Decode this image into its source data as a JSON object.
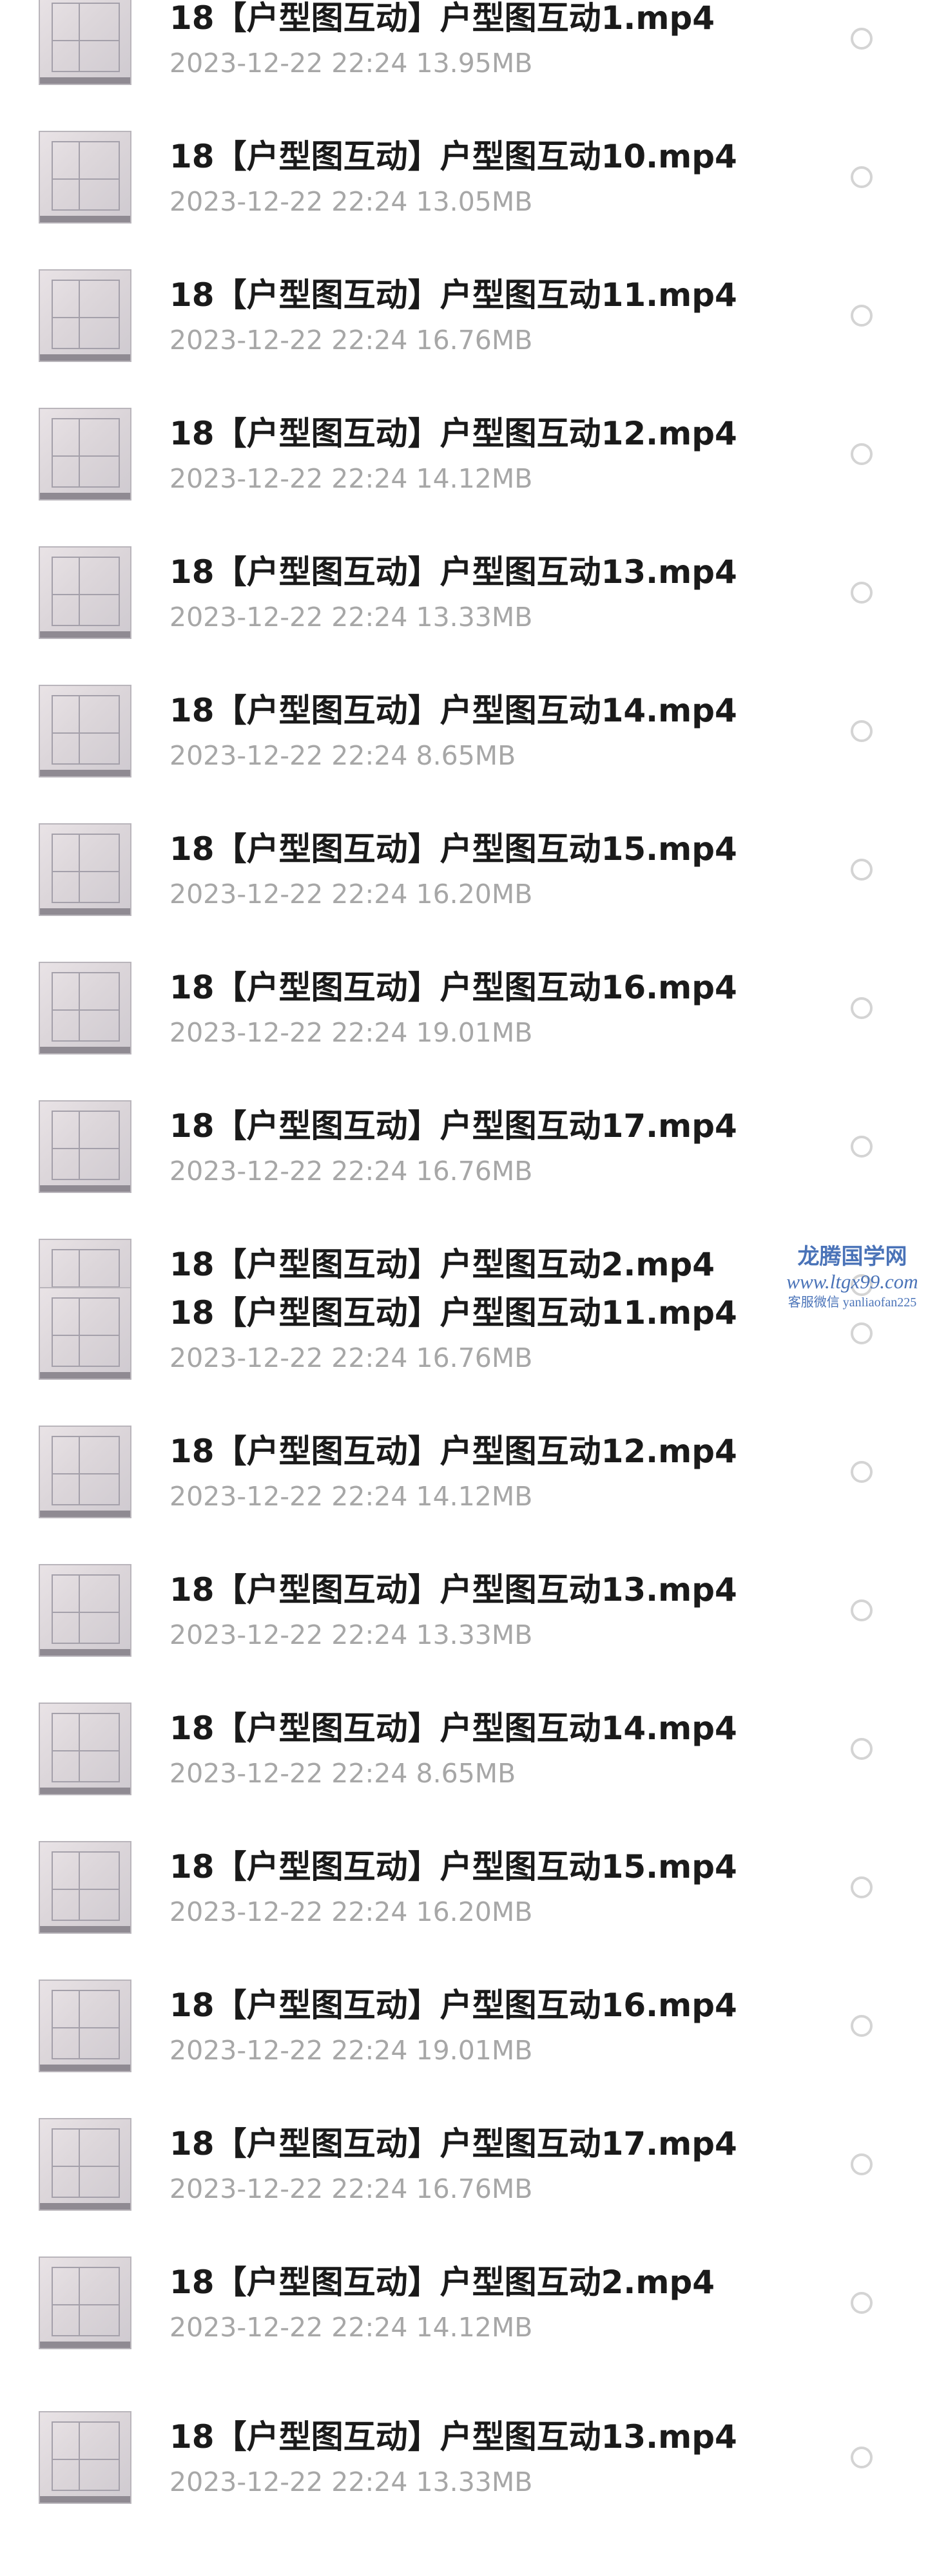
{
  "file_list": [
    {
      "name": "18【户型图互动】户型图互动1.mp4",
      "meta": "2023-12-22  22:24  13.95MB"
    },
    {
      "name": "18【户型图互动】户型图互动10.mp4",
      "meta": "2023-12-22  22:24  13.05MB"
    },
    {
      "name": "18【户型图互动】户型图互动11.mp4",
      "meta": "2023-12-22  22:24  16.76MB"
    },
    {
      "name": "18【户型图互动】户型图互动12.mp4",
      "meta": "2023-12-22  22:24  14.12MB"
    },
    {
      "name": "18【户型图互动】户型图互动13.mp4",
      "meta": "2023-12-22  22:24  13.33MB"
    },
    {
      "name": "18【户型图互动】户型图互动14.mp4",
      "meta": "2023-12-22  22:24  8.65MB"
    },
    {
      "name": "18【户型图互动】户型图互动15.mp4",
      "meta": "2023-12-22  22:24  16.20MB"
    },
    {
      "name": "18【户型图互动】户型图互动16.mp4",
      "meta": "2023-12-22  22:24  19.01MB"
    },
    {
      "name": "18【户型图互动】户型图互动17.mp4",
      "meta": "2023-12-22  22:24  16.76MB"
    },
    {
      "name": "18【户型图互动】户型图互动2.mp4",
      "meta": ""
    },
    {
      "name": "18【户型图互动】户型图互动11.mp4",
      "meta": "2023-12-22  22:24  16.76MB"
    },
    {
      "name": "18【户型图互动】户型图互动12.mp4",
      "meta": "2023-12-22  22:24  14.12MB"
    },
    {
      "name": "18【户型图互动】户型图互动13.mp4",
      "meta": "2023-12-22  22:24  13.33MB"
    },
    {
      "name": "18【户型图互动】户型图互动14.mp4",
      "meta": "2023-12-22  22:24  8.65MB"
    },
    {
      "name": "18【户型图互动】户型图互动15.mp4",
      "meta": "2023-12-22  22:24  16.20MB"
    },
    {
      "name": "18【户型图互动】户型图互动16.mp4",
      "meta": "2023-12-22  22:24  19.01MB"
    },
    {
      "name": "18【户型图互动】户型图互动17.mp4",
      "meta": "2023-12-22  22:24  16.76MB"
    },
    {
      "name": "18【户型图互动】户型图互动2.mp4",
      "meta": "2023-12-22  22:24  14.12MB"
    },
    {
      "name": "18【户型图互动】户型图互动13.mp4",
      "meta": "2023-12-22  22:24  13.33MB"
    }
  ],
  "watermark": {
    "title": "龙腾国学网",
    "url": "www.ltgx99.com",
    "contact": "客服微信 yanliaofan225"
  },
  "icons": {
    "thumbnail": "video-thumbnail-icon",
    "select": "radio-unchecked-icon"
  },
  "colors": {
    "name_text": "#1a1a1a",
    "meta_text": "#a7a7a7",
    "radio_border": "#d4d4d4",
    "watermark": "#4a73b8"
  }
}
